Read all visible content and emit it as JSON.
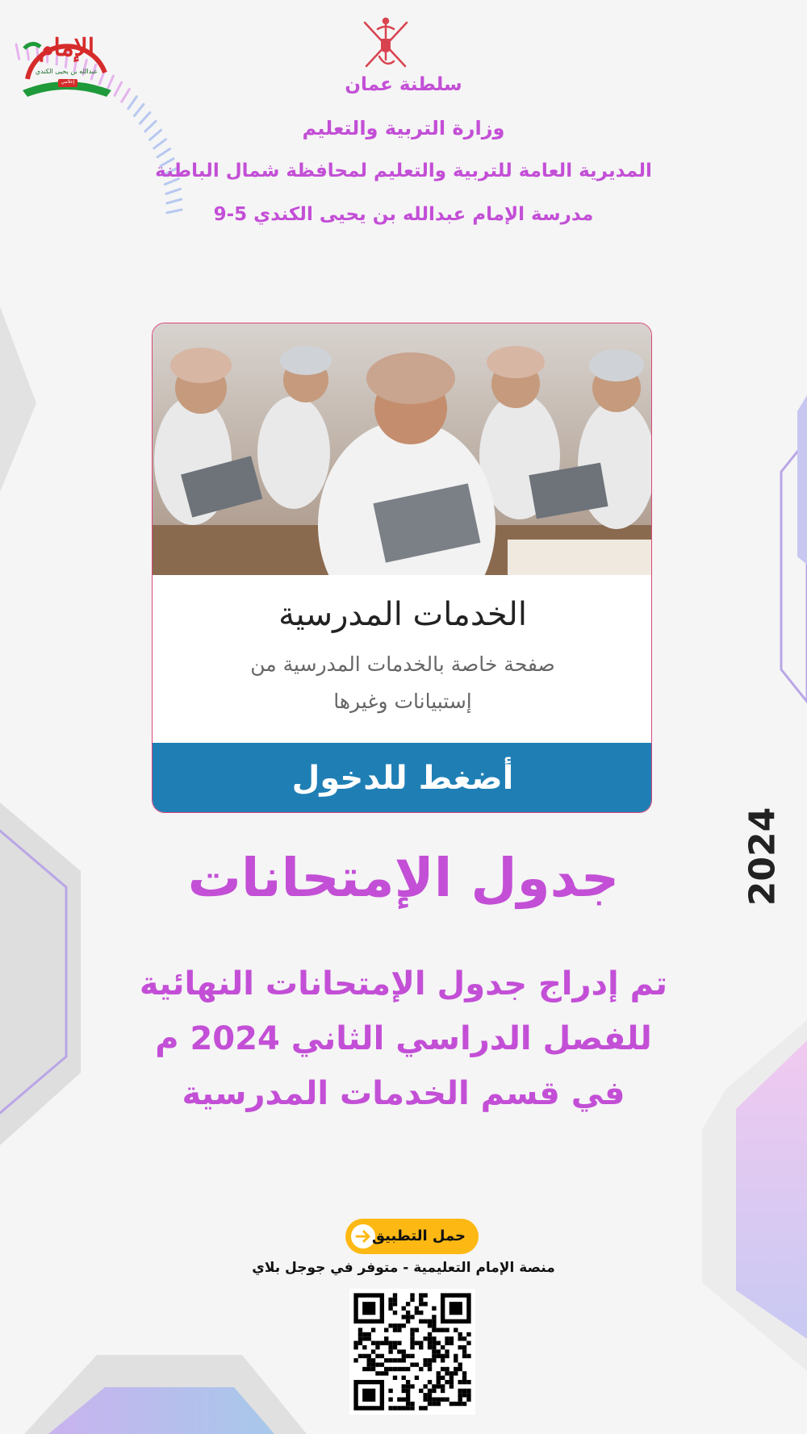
{
  "header": {
    "country": "سلطنة عمان",
    "ministry": "وزارة التربية والتعليم",
    "directorate": "المديرية العامة للتربية والتعليم لمحافظة شمال الباطنة",
    "school": "مدرسة الإمام عبدالله بن يحيى الكندي 5-9"
  },
  "logo": {
    "main_text": "الإمام",
    "sub_text": "عبدالله بن يحيى الكندي",
    "badge_text": "إعلامي"
  },
  "card": {
    "title": "الخدمات المدرسية",
    "description": "صفحة خاصة بالخدمات المدرسية من إستبيانات وغيرها",
    "button_label": "أضغط للدخول"
  },
  "announcement": {
    "title": "جدول الإمتحانات",
    "line1": "تم إدراج جدول الإمتحانات النهائية",
    "line2": "للفصل الدراسي الثاني 2024 م",
    "line3": "في قسم الخدمات المدرسية"
  },
  "year_label": "2024",
  "app": {
    "download_label": "حمل التطبيق",
    "platform_text": "منصة الإمام التعليمية - متوفر في جوجل بلاي"
  },
  "colors": {
    "accent_purple": "#c34fd6",
    "button_blue": "#1f7fb5",
    "download_yellow": "#fdb813",
    "emblem_red": "#d9434f"
  }
}
